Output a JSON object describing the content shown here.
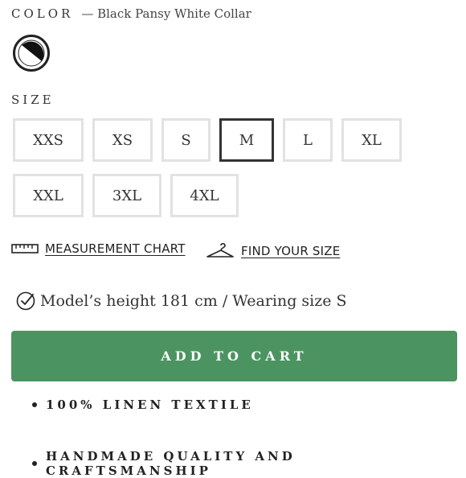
{
  "color": {
    "label": "COLOR",
    "value": "— Black Pansy White Collar",
    "swatch_icon": "black-white-collar-swatch"
  },
  "size": {
    "label": "SIZE",
    "options": [
      "XXS",
      "XS",
      "S",
      "M",
      "L",
      "XL",
      "XXL",
      "3XL",
      "4XL"
    ],
    "selected": "M"
  },
  "links": {
    "measurement_chart": "MEASUREMENT CHART",
    "measurement_icon": "ruler-icon",
    "find_size": "FIND YOUR SIZE",
    "find_size_icon": "hanger-icon"
  },
  "model_info": {
    "text": "Model’s height 181 cm / Wearing size S",
    "icon": "check-circle-icon"
  },
  "cart": {
    "label": "ADD TO CART",
    "color": "#4b9461"
  },
  "features": [
    "100% LINEN TEXTILE",
    "HANDMADE QUALITY AND CRAFTSMANSHIP"
  ]
}
